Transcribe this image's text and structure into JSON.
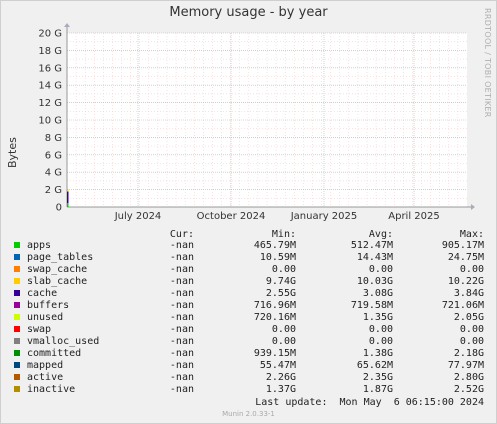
{
  "chart_data": {
    "type": "line",
    "title": "Memory usage - by year",
    "ylabel": "Bytes",
    "watermark": "RRDTOOL / TOBI OETIKER",
    "y_ticks": [
      "0",
      "2 G",
      "4 G",
      "6 G",
      "8 G",
      "10 G",
      "12 G",
      "14 G",
      "16 G",
      "18 G",
      "20 G"
    ],
    "ylim": [
      0,
      20
    ],
    "y_unit": "G",
    "x_ticks": [
      "July 2024",
      "October 2024",
      "January 2025",
      "April 2025"
    ],
    "grid": true,
    "legend_headers": {
      "cur": "Cur:",
      "min": "Min:",
      "avg": "Avg:",
      "max": "Max:"
    },
    "series": [
      {
        "name": "apps",
        "color": "#00cc00",
        "cur": "-nan",
        "min": "465.79M",
        "avg": "512.47M",
        "max": "905.17M"
      },
      {
        "name": "page_tables",
        "color": "#0066b3",
        "cur": "-nan",
        "min": "10.59M",
        "avg": "14.43M",
        "max": "24.75M"
      },
      {
        "name": "swap_cache",
        "color": "#ff8000",
        "cur": "-nan",
        "min": "0.00",
        "avg": "0.00",
        "max": "0.00"
      },
      {
        "name": "slab_cache",
        "color": "#ffcc00",
        "cur": "-nan",
        "min": "9.74G",
        "avg": "10.03G",
        "max": "10.22G"
      },
      {
        "name": "cache",
        "color": "#330099",
        "cur": "-nan",
        "min": "2.55G",
        "avg": "3.08G",
        "max": "3.84G"
      },
      {
        "name": "buffers",
        "color": "#990099",
        "cur": "-nan",
        "min": "716.96M",
        "avg": "719.58M",
        "max": "721.06M"
      },
      {
        "name": "unused",
        "color": "#ccff00",
        "cur": "-nan",
        "min": "720.16M",
        "avg": "1.35G",
        "max": "2.05G"
      },
      {
        "name": "swap",
        "color": "#ff0000",
        "cur": "-nan",
        "min": "0.00",
        "avg": "0.00",
        "max": "0.00"
      },
      {
        "name": "vmalloc_used",
        "color": "#808080",
        "cur": "-nan",
        "min": "0.00",
        "avg": "0.00",
        "max": "0.00"
      },
      {
        "name": "committed",
        "color": "#008f00",
        "cur": "-nan",
        "min": "939.15M",
        "avg": "1.38G",
        "max": "2.18G"
      },
      {
        "name": "mapped",
        "color": "#00487d",
        "cur": "-nan",
        "min": "55.47M",
        "avg": "65.62M",
        "max": "77.97M"
      },
      {
        "name": "active",
        "color": "#b35a00",
        "cur": "-nan",
        "min": "2.26G",
        "avg": "2.35G",
        "max": "2.80G"
      },
      {
        "name": "inactive",
        "color": "#b38f00",
        "cur": "-nan",
        "min": "1.37G",
        "avg": "1.87G",
        "max": "2.52G"
      }
    ],
    "last_update": "Last update:  Mon May  6 06:15:00 2024",
    "footer": "Munin 2.0.33-1"
  }
}
